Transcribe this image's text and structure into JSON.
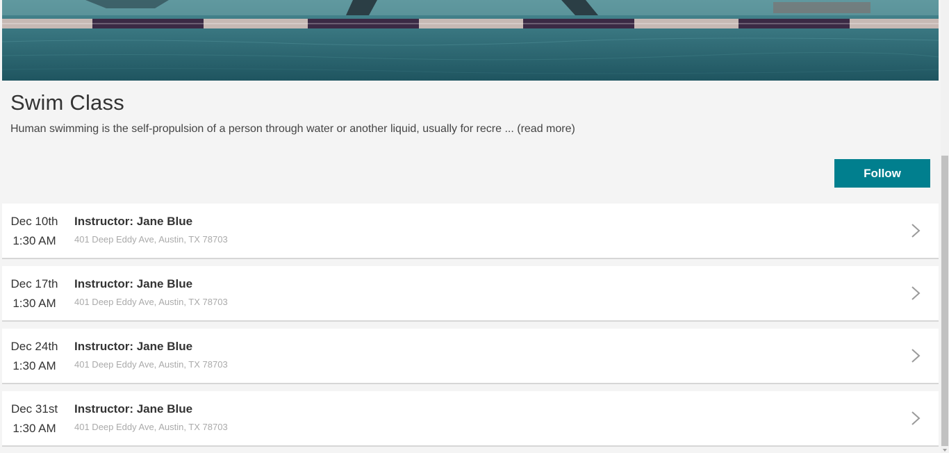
{
  "hero": {
    "image": "swimming-pool-lane-image"
  },
  "class": {
    "title": "Swim Class",
    "description": "Human swimming is the self-propulsion of a person through water or another liquid, usually for recre",
    "ellipsis": " ... ",
    "read_more": "(read more)",
    "follow_label": "Follow"
  },
  "colors": {
    "accent": "#017f8e",
    "background": "#f4f4f4",
    "address_text": "#aaaaaa"
  },
  "events": [
    {
      "day": "Dec 10th",
      "time": "1:30 AM",
      "instructor": "Instructor: Jane Blue",
      "address": "401 Deep Eddy Ave, Austin, TX 78703",
      "icon": "chevron-right-icon"
    },
    {
      "day": "Dec 17th",
      "time": "1:30 AM",
      "instructor": "Instructor: Jane Blue",
      "address": "401 Deep Eddy Ave, Austin, TX 78703",
      "icon": "chevron-right-icon"
    },
    {
      "day": "Dec 24th",
      "time": "1:30 AM",
      "instructor": "Instructor: Jane Blue",
      "address": "401 Deep Eddy Ave, Austin, TX 78703",
      "icon": "chevron-right-icon"
    },
    {
      "day": "Dec 31st",
      "time": "1:30 AM",
      "instructor": "Instructor: Jane Blue",
      "address": "401 Deep Eddy Ave, Austin, TX 78703",
      "icon": "chevron-right-icon"
    }
  ]
}
